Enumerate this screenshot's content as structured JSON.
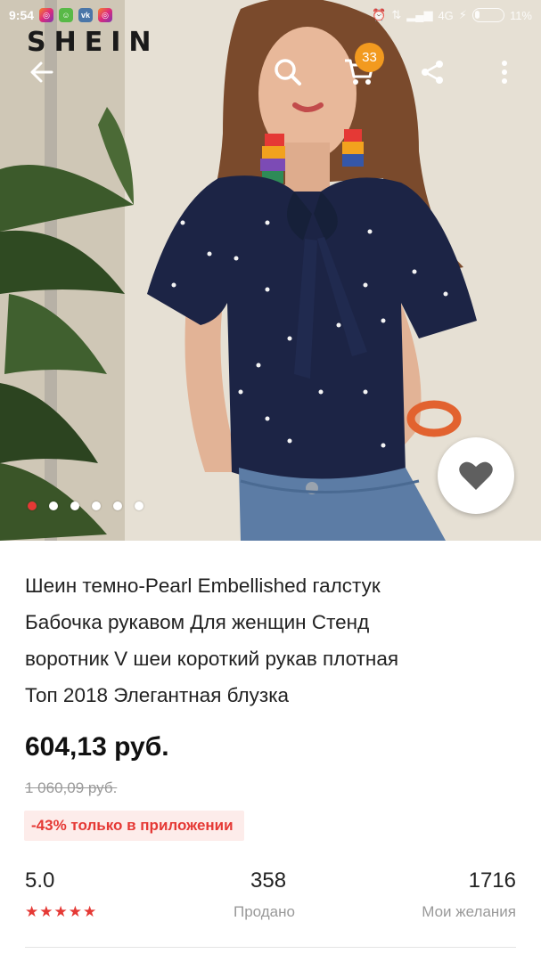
{
  "status_bar": {
    "time": "9:54",
    "network": "4G",
    "battery": "11%",
    "apps": [
      "instagram-icon",
      "android-icon",
      "vk-icon",
      "instagram-icon"
    ]
  },
  "brand": "SHEIN",
  "cart": {
    "count": "33"
  },
  "gallery": {
    "image_count": 6,
    "active_index": 0
  },
  "product": {
    "title_lines": [
      "Шеин темно-Pearl Embellished галстук",
      "Бабочка рукавом Для женщин Стенд",
      "воротник V шеи короткий рукав плотная",
      "Топ 2018 Элегантная блузка"
    ],
    "price": "604,13 руб.",
    "old_price": "1 060,09 руб.",
    "promo": "-43% только в приложении"
  },
  "stats": {
    "rating": "5.0",
    "rating_stars": 5,
    "sold_value": "358",
    "sold_label": "Продано",
    "wishlist_value": "1716",
    "wishlist_label": "Мои желания"
  },
  "colors": {
    "accent_red": "#e53935",
    "badge_orange": "#f29a1f",
    "promo_bg": "#fdecea",
    "blouse_navy": "#1c2445"
  }
}
